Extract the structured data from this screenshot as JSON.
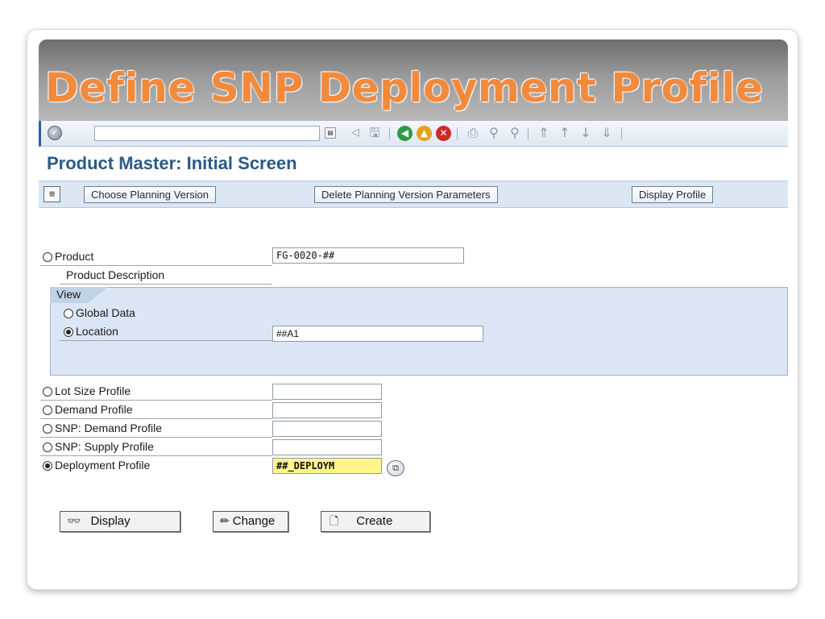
{
  "banner": {
    "title": "Define SNP Deployment Profile"
  },
  "toolbar": {
    "icons": [
      "enter-check-icon",
      "command-history-icon",
      "back-arrow-icon",
      "save-icon",
      "back-icon",
      "exit-icon",
      "cancel-icon",
      "print-icon",
      "find-icon",
      "find-next-icon",
      "first-page-icon",
      "previous-page-icon",
      "next-page-icon",
      "last-page-icon"
    ],
    "command_value": ""
  },
  "screen": {
    "title": "Product Master: Initial Screen"
  },
  "appbar": {
    "buttons": [
      {
        "label": "Choose Planning Version"
      },
      {
        "label": "Delete Planning Version Parameters"
      },
      {
        "label": "Display Profile"
      }
    ]
  },
  "form": {
    "product": {
      "label": "Product",
      "value": "FG-0020-##",
      "selected": false
    },
    "product_description": {
      "label": "Product Description"
    },
    "view": {
      "label": "View",
      "global_data": {
        "label": "Global Data",
        "selected": false
      },
      "location": {
        "label": "Location",
        "value": "##A1",
        "selected": true
      }
    },
    "profiles": [
      {
        "label": "Lot Size Profile",
        "value": "",
        "selected": false
      },
      {
        "label": "Demand Profile",
        "value": "",
        "selected": false
      },
      {
        "label": "SNP: Demand Profile",
        "value": "",
        "selected": false
      },
      {
        "label": "SNP: Supply Profile",
        "value": "",
        "selected": false
      },
      {
        "label": "Deployment Profile",
        "value": "##_DEPLOYM",
        "selected": true
      }
    ]
  },
  "actions": {
    "display": {
      "label": "Display",
      "icon": "glasses-icon"
    },
    "change": {
      "label": "Change",
      "icon": "pencil-icon"
    },
    "create": {
      "label": "Create",
      "icon": "blank-page-icon"
    }
  },
  "colors": {
    "banner_title": "#f28a3c",
    "screen_title": "#2b5a86",
    "panel_bg": "#dbe6f4",
    "highlight_field": "#fff58c"
  }
}
